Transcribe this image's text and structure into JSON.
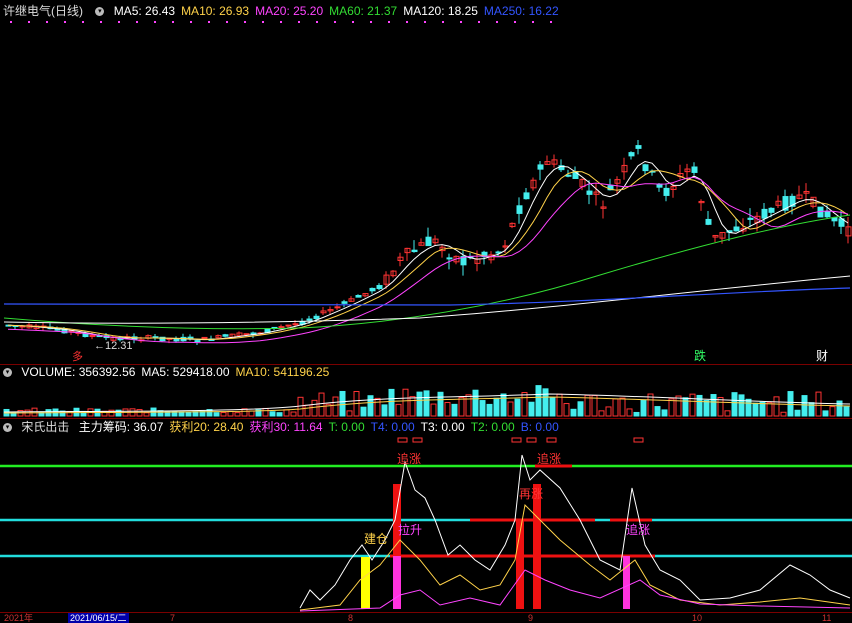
{
  "main_panel": {
    "title": "许继电气(日线)",
    "indicators": [
      {
        "label": "MA5: 26.43",
        "color": "#ffffff"
      },
      {
        "label": "MA10: 26.93",
        "color": "#ffd24a"
      },
      {
        "label": "MA20: 25.20",
        "color": "#ff44ff"
      },
      {
        "label": "MA60: 21.37",
        "color": "#33dd33"
      },
      {
        "label": "MA120: 18.25",
        "color": "#ffffff"
      },
      {
        "label": "MA250: 16.22",
        "color": "#3355ff"
      }
    ],
    "low_label": "←12.31",
    "markers": [
      {
        "text": "多",
        "color": "#ff3333"
      },
      {
        "text": "跌",
        "color": "#33ff66"
      },
      {
        "text": "财",
        "color": "#ffffff"
      }
    ]
  },
  "volume_panel": {
    "items": [
      {
        "label": "VOLUME: 356392.56",
        "color": "#ffffff"
      },
      {
        "label": "MA5: 529418.00",
        "color": "#ffffff"
      },
      {
        "label": "MA10: 541196.25",
        "color": "#ffd24a"
      }
    ]
  },
  "signal_panel": {
    "name": "宋氏出击",
    "items": [
      {
        "label": "主力筹码: 36.07",
        "color": "#ffffff"
      },
      {
        "label": "获利20: 28.40",
        "color": "#ffd24a"
      },
      {
        "label": "获利30: 11.64",
        "color": "#ff44ff"
      },
      {
        "label": "T: 0.00",
        "color": "#33dd33"
      },
      {
        "label": "T4: 0.00",
        "color": "#3355ff"
      },
      {
        "label": "T3: 0.00",
        "color": "#ffffff"
      },
      {
        "label": "T2: 0.00",
        "color": "#33dd33"
      },
      {
        "label": "B: 0.00",
        "color": "#3355ff"
      }
    ],
    "tags": [
      {
        "text": "追涨",
        "color": "#ff3333"
      },
      {
        "text": "追涨",
        "color": "#ff3333"
      },
      {
        "text": "拉升",
        "color": "#ff44ff"
      },
      {
        "text": "建仓",
        "color": "#ffd24a"
      },
      {
        "text": "再涨",
        "color": "#ff3333"
      },
      {
        "text": "追涨",
        "color": "#ff44ff"
      }
    ]
  },
  "time_axis": {
    "labels": [
      "2021年",
      "2021/06/15/二",
      "7",
      "8",
      "9",
      "10",
      "11"
    ]
  },
  "colors": {
    "up": "#ff3333",
    "down": "#44eeee",
    "bg": "#000000",
    "grid": "#7a0000"
  }
}
